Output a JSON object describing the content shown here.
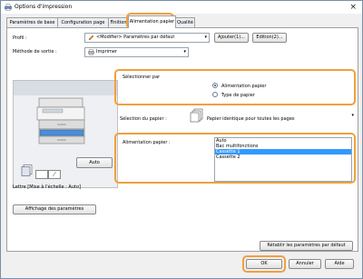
{
  "window": {
    "title": "Options d'impression",
    "close_glyph": "×"
  },
  "tabs": [
    {
      "label": "Paramètres de base"
    },
    {
      "label": "Configuration page"
    },
    {
      "label": "Finition"
    },
    {
      "label": "Alimentation papier",
      "active": true
    },
    {
      "label": "Qualité"
    }
  ],
  "profile": {
    "label": "Profil :",
    "value": "<Modifier> Paramètres par défaut",
    "add_label": "Ajouter(1)...",
    "edit_label": "Edition(2)..."
  },
  "output": {
    "label": "Méthode de sortie :",
    "value": "Imprimer"
  },
  "select_by": {
    "label": "Sélectionner par",
    "options": [
      {
        "label": "Alimentation papier",
        "checked": true
      },
      {
        "label": "Type de papier",
        "checked": false
      }
    ]
  },
  "paper_selection": {
    "label": "Sélection du papier :",
    "value": "Papier identique pour toutes les pages"
  },
  "paper_source": {
    "label": "Alimentation papier :",
    "items": [
      {
        "label": "Auto"
      },
      {
        "label": "Bac multifonctions"
      },
      {
        "label": "Cassette 1",
        "selected": true
      },
      {
        "label": "Cassette 2"
      }
    ]
  },
  "preview": {
    "auto_label": "Auto",
    "caption": "Lettre [Mise à l'échelle : Auto]"
  },
  "buttons": {
    "show_settings": "Affichage des paramètres",
    "restore_defaults": "Rétablir les paramètres par défaut",
    "ok": "OK",
    "cancel": "Annuler",
    "help": "Aide"
  },
  "colors": {
    "highlight": "#f0a040",
    "selection": "#3399ff"
  }
}
